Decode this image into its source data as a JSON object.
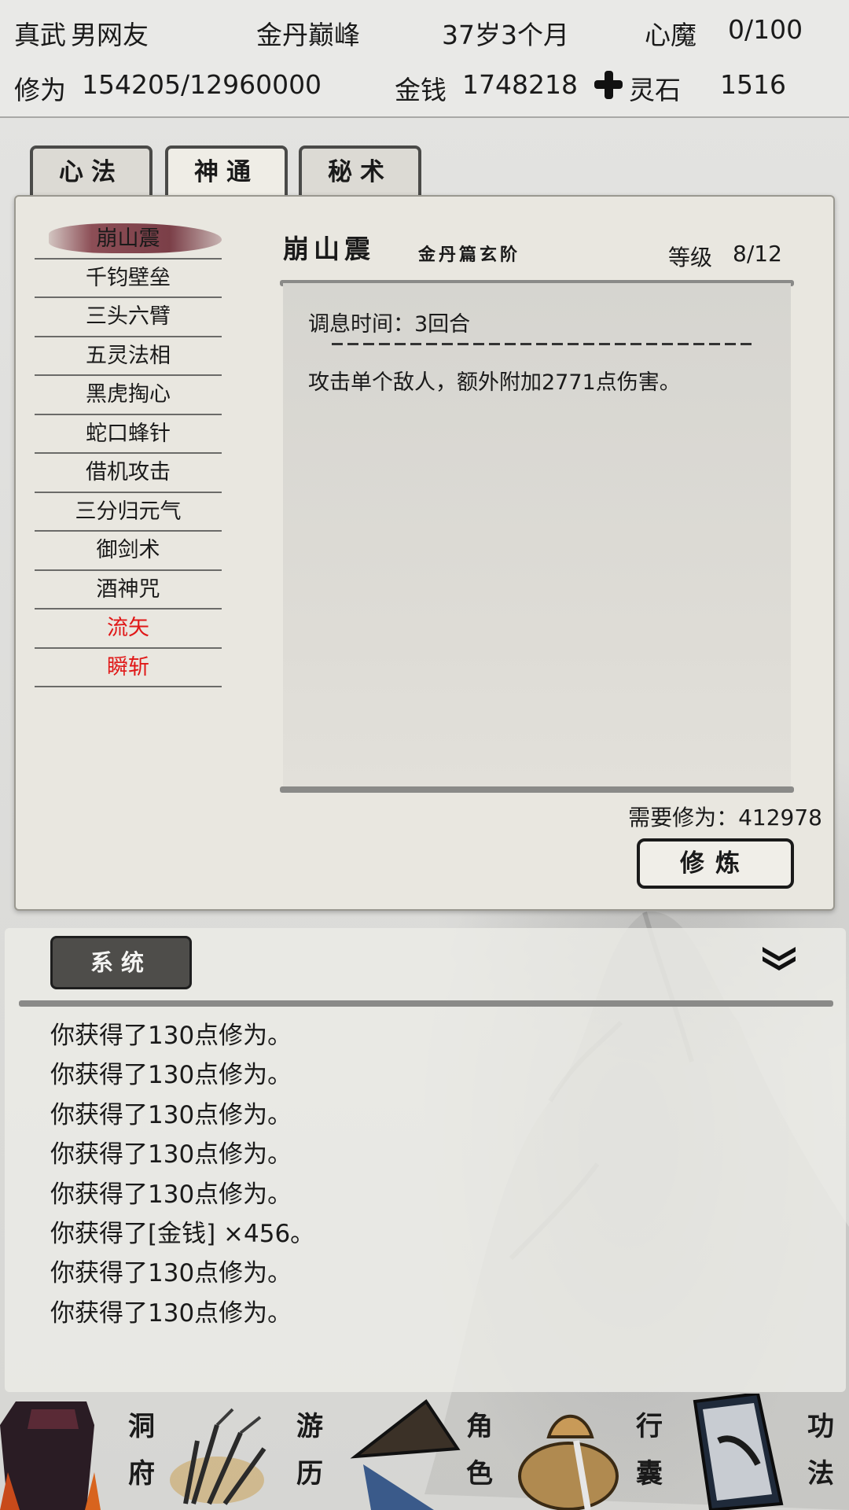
{
  "header": {
    "name": "真武",
    "gender": "男网友",
    "realm": "金丹巅峰",
    "age": "37岁3个月",
    "demon_label": "心魔",
    "demon_value": "0/100",
    "cultivation_label": "修为",
    "cultivation_value": "154205/12960000",
    "money_label": "金钱",
    "money_value": "1748218",
    "stone_label": "灵石",
    "stone_value": "1516"
  },
  "tabs": [
    {
      "label": "心法",
      "active": false
    },
    {
      "label": "神通",
      "active": true
    },
    {
      "label": "秘术",
      "active": false
    }
  ],
  "skills": [
    {
      "name": "崩山震",
      "selected": true,
      "color": "#1a1a1a"
    },
    {
      "name": "千钧壁垒",
      "color": "#1a1a1a"
    },
    {
      "name": "三头六臂",
      "color": "#1a1a1a"
    },
    {
      "name": "五灵法相",
      "color": "#1a1a1a"
    },
    {
      "name": "黑虎掏心",
      "color": "#1a1a1a"
    },
    {
      "name": "蛇口蜂针",
      "color": "#1a1a1a"
    },
    {
      "name": "借机攻击",
      "color": "#1a1a1a"
    },
    {
      "name": "三分归元气",
      "color": "#1a1a1a"
    },
    {
      "name": "御剑术",
      "color": "#1a1a1a"
    },
    {
      "name": "酒神咒",
      "color": "#1a1a1a"
    },
    {
      "name": "流矢",
      "color": "#e01818"
    },
    {
      "name": "瞬斩",
      "color": "#e01818"
    }
  ],
  "detail": {
    "title": "崩山震",
    "subtitle": "金丹篇玄阶",
    "level_label": "等级",
    "level_value": "8/12",
    "cooldown": "调息时间：3回合",
    "description": "攻击单个敌人，额外附加2771点伤害。",
    "cost": "需要修为：412978",
    "train_button": "修炼"
  },
  "log": {
    "tab_label": "系统",
    "lines": [
      "你获得了130点修为。",
      "你获得了130点修为。",
      "你获得了130点修为。",
      "你获得了130点修为。",
      "你获得了130点修为。",
      "你获得了[金钱] ×456。",
      "你获得了130点修为。",
      "你获得了130点修为。"
    ]
  },
  "nav": [
    {
      "label": "洞府",
      "icon": "cave-banner-icon"
    },
    {
      "label": "游历",
      "icon": "reeds-icon"
    },
    {
      "label": "角色",
      "icon": "straw-hat-icon"
    },
    {
      "label": "行囊",
      "icon": "bag-icon"
    },
    {
      "label": "功法",
      "icon": "scroll-book-icon"
    }
  ]
}
